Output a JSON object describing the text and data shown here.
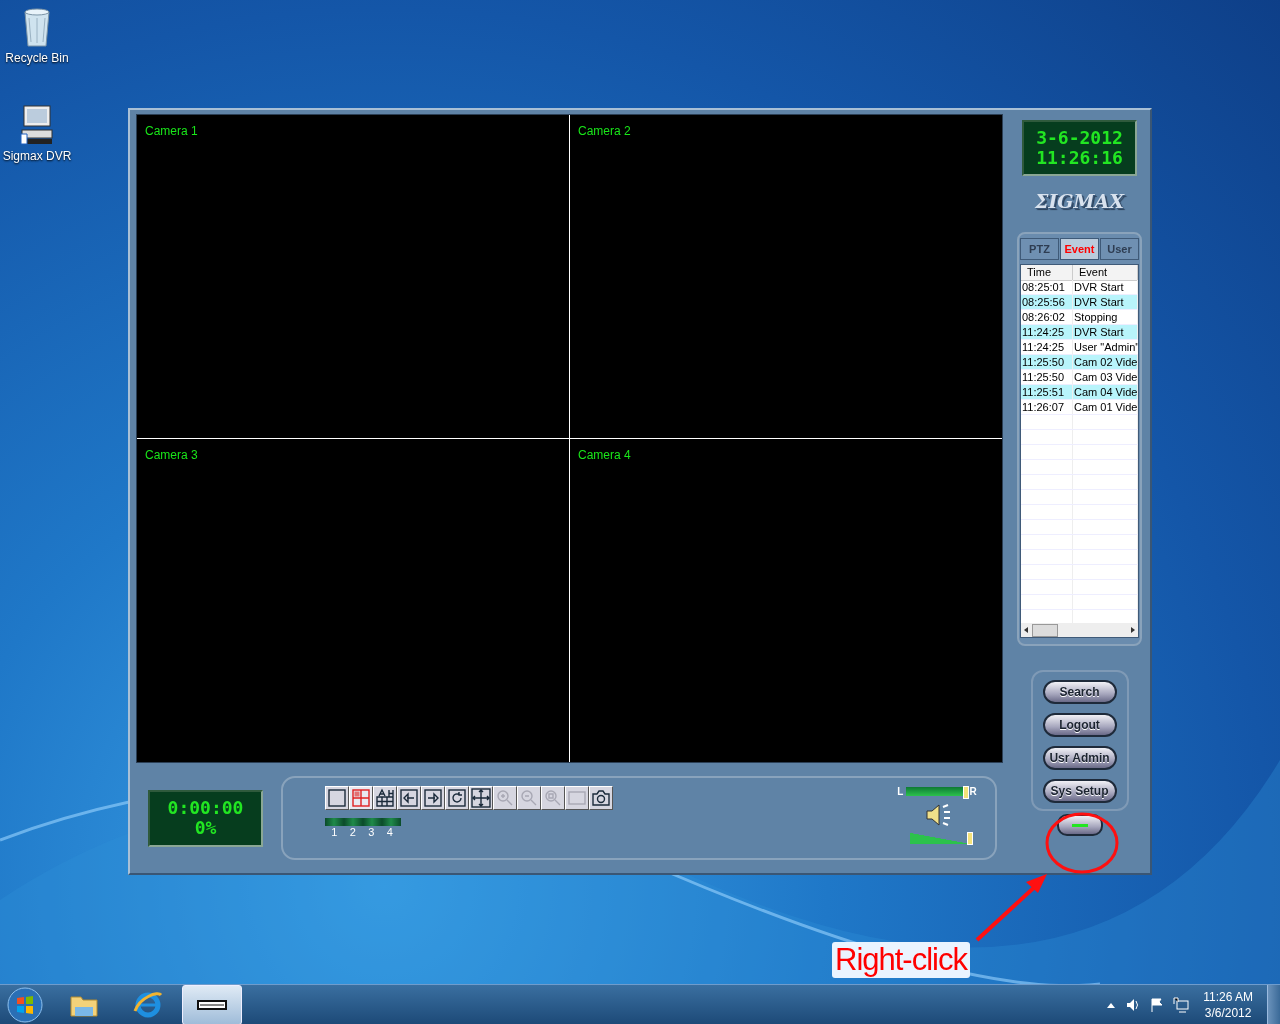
{
  "desktop_icons": [
    {
      "label": "Recycle Bin",
      "kind": "recycle"
    },
    {
      "label": "Sigmax DVR",
      "kind": "dvr"
    }
  ],
  "app": {
    "cameras": [
      {
        "label": "Camera 1"
      },
      {
        "label": "Camera 2"
      },
      {
        "label": "Camera 3"
      },
      {
        "label": "Camera 4"
      }
    ],
    "clock": {
      "date": "3-6-2012",
      "time": "11:26:16"
    },
    "logo": "ΣIGMAX",
    "tabs": [
      {
        "label": "PTZ",
        "selected": false
      },
      {
        "label": "Event",
        "selected": true
      },
      {
        "label": "User",
        "selected": false
      }
    ],
    "event_log": {
      "columns": [
        "Time",
        "Event"
      ],
      "rows": [
        {
          "time": "08:25:01",
          "event": "DVR Start"
        },
        {
          "time": "08:25:56",
          "event": "DVR Start"
        },
        {
          "time": "08:26:02",
          "event": "Stopping"
        },
        {
          "time": "11:24:25",
          "event": "DVR Start"
        },
        {
          "time": "11:24:25",
          "event": "User \"Admin\""
        },
        {
          "time": "11:25:50",
          "event": "Cam 02 Vide"
        },
        {
          "time": "11:25:50",
          "event": "Cam 03 Vide"
        },
        {
          "time": "11:25:51",
          "event": "Cam 04 Vide"
        },
        {
          "time": "11:26:07",
          "event": "Cam 01 Vide"
        }
      ]
    },
    "buttons": [
      "Search",
      "Logout",
      "Usr Admin",
      "Sys Setup"
    ],
    "playback": {
      "time": "0:00:00",
      "progress": "0%"
    },
    "toolbar": [
      {
        "kind": "single",
        "selected": false,
        "disabled": false
      },
      {
        "kind": "quad",
        "selected": true,
        "disabled": false
      },
      {
        "kind": "multi",
        "selected": false,
        "disabled": false
      },
      {
        "kind": "prev",
        "selected": false,
        "disabled": false
      },
      {
        "kind": "next",
        "selected": false,
        "disabled": false
      },
      {
        "kind": "cycle",
        "selected": false,
        "disabled": false
      },
      {
        "kind": "move",
        "selected": false,
        "disabled": false
      },
      {
        "kind": "zoom-in",
        "selected": false,
        "disabled": true
      },
      {
        "kind": "zoom-out",
        "selected": false,
        "disabled": true
      },
      {
        "kind": "zoom-fit",
        "selected": false,
        "disabled": true
      },
      {
        "kind": "rect",
        "selected": false,
        "disabled": true
      },
      {
        "kind": "snapshot",
        "selected": false,
        "disabled": false
      }
    ],
    "channels": [
      "1",
      "2",
      "3",
      "4"
    ],
    "audio": {
      "left_label": "L",
      "right_label": "R",
      "balance": {
        "level": 1
      },
      "volume": {
        "level": 1
      }
    }
  },
  "annotation": {
    "label": "Right-click"
  },
  "taskbar": {
    "items": [
      {
        "kind": "folder",
        "selected": false
      },
      {
        "kind": "browser",
        "selected": false
      },
      {
        "kind": "dvr",
        "selected": true
      }
    ],
    "tray": {
      "time": "11:26 AM",
      "date": "3/6/2012"
    }
  }
}
